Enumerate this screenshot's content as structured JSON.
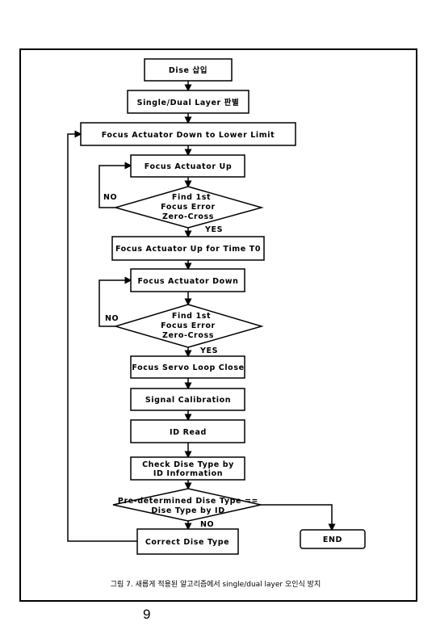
{
  "flowchart": {
    "nodes": {
      "disc_insert": "Dise 삽입",
      "layer_detect": "Single/Dual Layer 판별",
      "down_lower_limit": "Focus Actuator Down to Lower Limit",
      "actuator_up": "Focus Actuator Up",
      "find1_l1": "Find 1st",
      "find1_l2": "Focus Error",
      "find1_l3": "Zero-Cross",
      "up_time": "Focus Actuator Up for Time T0",
      "actuator_down": "Focus Actuator Down",
      "find2_l1": "Find 1st",
      "find2_l2": "Focus Error",
      "find2_l3": "Zero-Cross",
      "servo_close": "Focus Servo Loop Close",
      "signal_cal": "Signal Calibration",
      "id_read": "ID Read",
      "check_l1": "Check Dise Type by",
      "check_l2": "ID Information",
      "compare_l1": "Pre-determined Dise Type ==",
      "compare_l2": "Dise Type by ID",
      "correct": "Correct Dise Type",
      "end": "END"
    },
    "edge_labels": {
      "no1": "NO",
      "yes1": "YES",
      "no2": "NO",
      "yes2": "YES",
      "no3": "NO"
    }
  },
  "caption": "그림 7. 새롭게 적용된 알고리즘에서 single/dual layer 오인식 방지",
  "page_number": "9"
}
